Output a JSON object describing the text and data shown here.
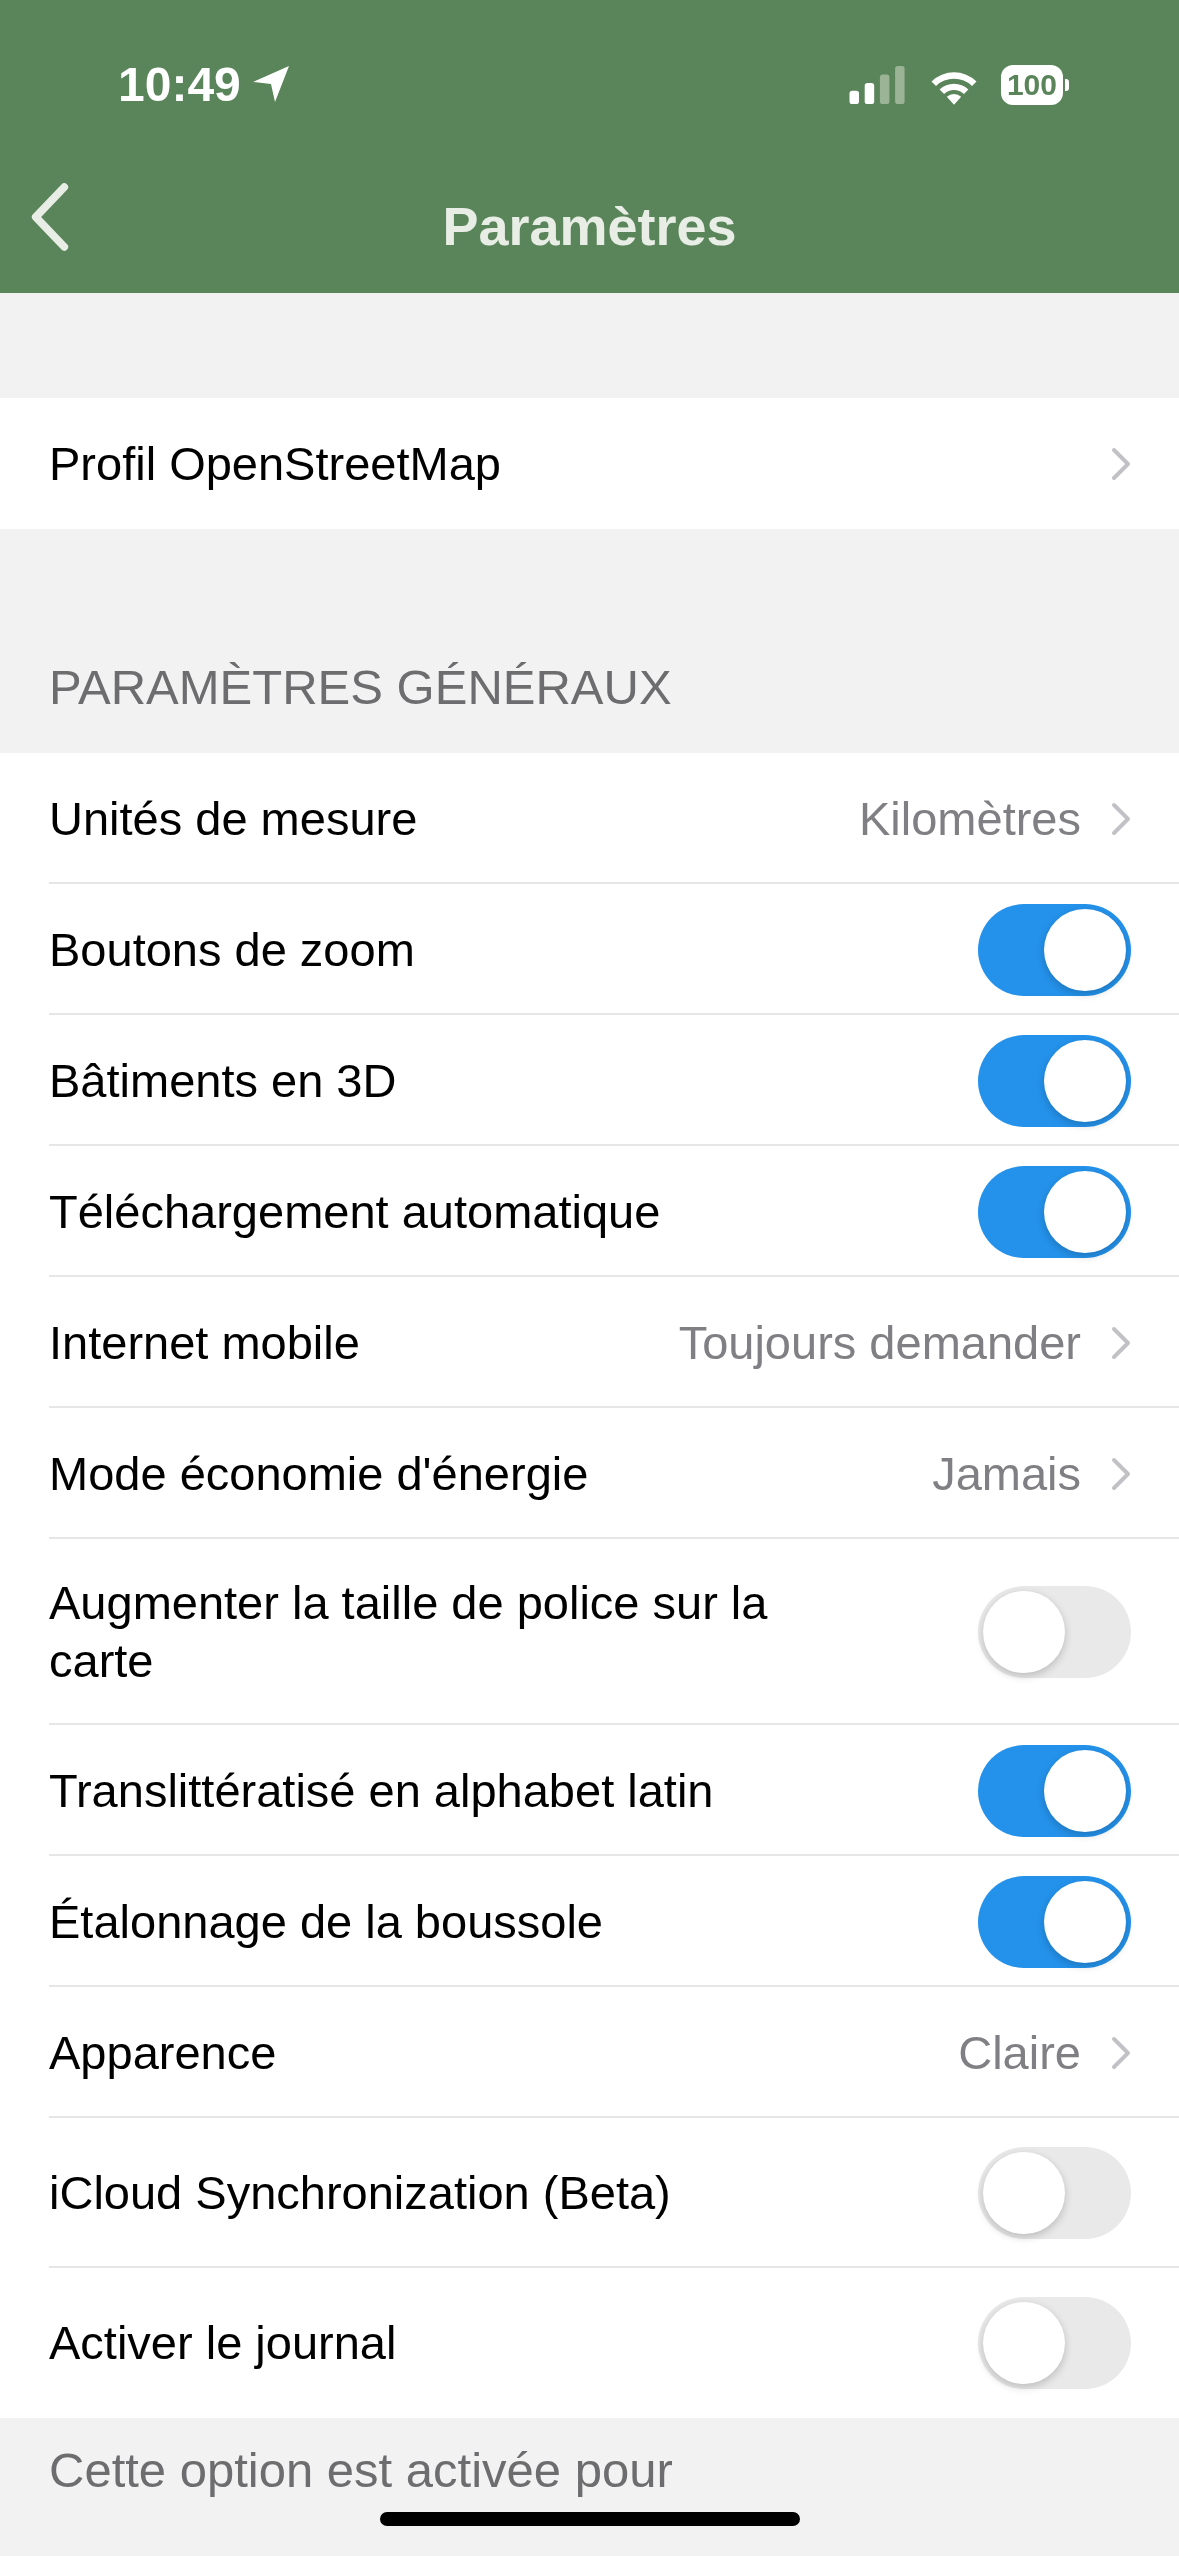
{
  "status_bar": {
    "time": "10:49",
    "battery": "100"
  },
  "nav": {
    "title": "Paramètres"
  },
  "profile_row": {
    "label": "Profil OpenStreetMap"
  },
  "section": {
    "header": "PARAMÈTRES GÉNÉRAUX",
    "rows": [
      {
        "kind": "value",
        "label": "Unités de mesure",
        "value": "Kilomètres"
      },
      {
        "kind": "toggle",
        "label": "Boutons de zoom",
        "on": true
      },
      {
        "kind": "toggle",
        "label": "Bâtiments en 3D",
        "on": true
      },
      {
        "kind": "toggle",
        "label": "Téléchargement automatique",
        "on": true
      },
      {
        "kind": "value",
        "label": "Internet mobile",
        "value": "Toujours demander"
      },
      {
        "kind": "value",
        "label": "Mode économie d'énergie",
        "value": "Jamais"
      },
      {
        "kind": "toggle",
        "label": "Augmenter la taille de police sur la carte",
        "on": false
      },
      {
        "kind": "toggle",
        "label": "Translittératisé en alphabet latin",
        "on": true
      },
      {
        "kind": "toggle",
        "label": "Étalonnage de la boussole",
        "on": true
      },
      {
        "kind": "value",
        "label": "Apparence",
        "value": "Claire"
      },
      {
        "kind": "toggle",
        "label": "iCloud Synchronization (Beta)",
        "on": false
      },
      {
        "kind": "toggle",
        "label": "Activer le journal",
        "on": false
      }
    ]
  },
  "footer": "Cette option est activée pour"
}
